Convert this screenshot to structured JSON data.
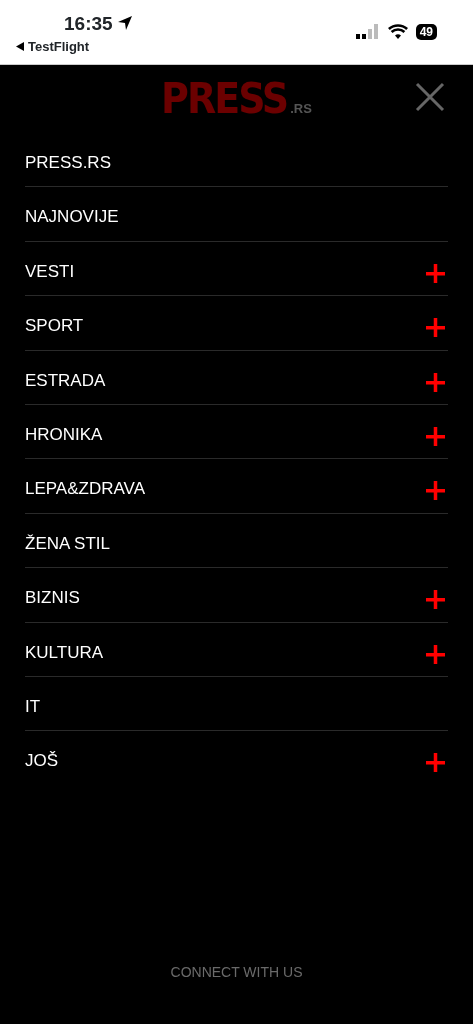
{
  "status_bar": {
    "time": "16:35",
    "back_label": "TestFlight",
    "battery": "49"
  },
  "header": {
    "logo": "PRESS",
    "logo_suffix": ".RS"
  },
  "menu": [
    {
      "label": "PRESS.RS",
      "expandable": false
    },
    {
      "label": "NAJNOVIJE",
      "expandable": false
    },
    {
      "label": "VESTI",
      "expandable": true
    },
    {
      "label": "SPORT",
      "expandable": true
    },
    {
      "label": "ESTRADA",
      "expandable": true
    },
    {
      "label": "HRONIKA",
      "expandable": true
    },
    {
      "label": "LEPA&ZDRAVA",
      "expandable": true
    },
    {
      "label": "ŽENA STIL",
      "expandable": false
    },
    {
      "label": "BIZNIS",
      "expandable": true
    },
    {
      "label": "KULTURA",
      "expandable": true
    },
    {
      "label": "IT",
      "expandable": false
    },
    {
      "label": "JOŠ",
      "expandable": true
    }
  ],
  "footer": {
    "text": "CONNECT WITH US"
  }
}
